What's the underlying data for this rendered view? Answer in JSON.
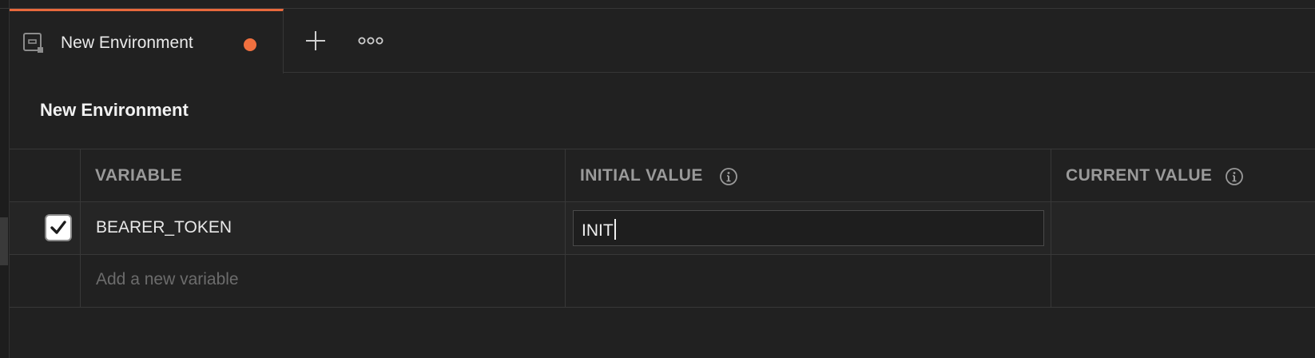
{
  "tab": {
    "label": "New Environment",
    "icon": "environment-icon",
    "unsaved_indicator_color": "#f0703f",
    "accent_color": "#e8693c"
  },
  "tab_actions": {
    "new_tab_icon": "plus-icon",
    "more_icon": "more-horizontal-icon"
  },
  "environment": {
    "title": "New Environment"
  },
  "table": {
    "columns": {
      "variable": "VARIABLE",
      "initial_value": "INITIAL VALUE",
      "current_value": "CURRENT VALUE"
    },
    "rows": [
      {
        "enabled": true,
        "variable": "BEARER_TOKEN",
        "initial_value": "INIT",
        "current_value": ""
      }
    ],
    "new_row_placeholder": "Add a new variable"
  }
}
